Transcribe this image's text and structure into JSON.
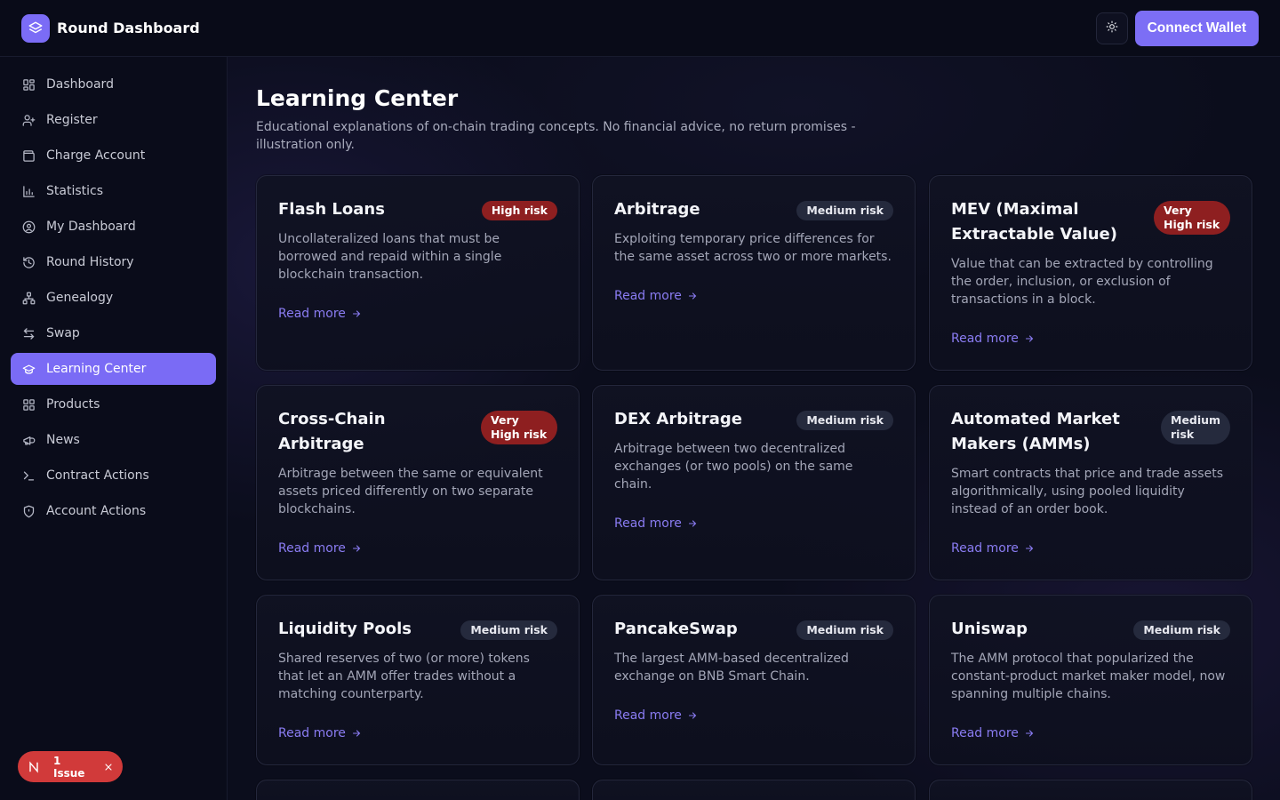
{
  "header": {
    "title": "Round Dashboard",
    "connect_label": "Connect Wallet"
  },
  "sidebar": {
    "items": [
      {
        "label": "Dashboard",
        "icon": "grid-icon"
      },
      {
        "label": "Register",
        "icon": "user-plus-icon"
      },
      {
        "label": "Charge Account",
        "icon": "wallet-icon"
      },
      {
        "label": "Statistics",
        "icon": "bar-chart-icon"
      },
      {
        "label": "My Dashboard",
        "icon": "user-circle-icon"
      },
      {
        "label": "Round History",
        "icon": "history-icon"
      },
      {
        "label": "Genealogy",
        "icon": "network-icon"
      },
      {
        "label": "Swap",
        "icon": "swap-icon"
      },
      {
        "label": "Learning Center",
        "icon": "graduation-cap-icon",
        "active": true
      },
      {
        "label": "Products",
        "icon": "grid-icon"
      },
      {
        "label": "News",
        "icon": "megaphone-icon"
      },
      {
        "label": "Contract Actions",
        "icon": "terminal-icon"
      },
      {
        "label": "Account Actions",
        "icon": "shield-icon"
      }
    ]
  },
  "issue_pill": {
    "label": "1 Issue",
    "color": "#d13a3a"
  },
  "main": {
    "title": "Learning Center",
    "subtitle": "Educational explanations of on-chain trading concepts. No financial advice, no return promises - illustration only.",
    "read_more_label": "Read more",
    "cards": [
      {
        "title": "Flash Loans",
        "risk": "High risk",
        "risk_level": "high",
        "desc": "Uncollateralized loans that must be borrowed and repaid within a single blockchain transaction."
      },
      {
        "title": "Arbitrage",
        "risk": "Medium risk",
        "risk_level": "medium",
        "desc": "Exploiting temporary price differences for the same asset across two or more markets."
      },
      {
        "title": "MEV (Maximal Extractable Value)",
        "risk": "Very High risk",
        "risk_level": "vhigh",
        "desc": "Value that can be extracted by controlling the order, inclusion, or exclusion of transactions in a block."
      },
      {
        "title": "Cross-Chain Arbitrage",
        "risk": "Very High risk",
        "risk_level": "vhigh",
        "desc": "Arbitrage between the same or equivalent assets priced differently on two separate blockchains."
      },
      {
        "title": "DEX Arbitrage",
        "risk": "Medium risk",
        "risk_level": "medium",
        "desc": "Arbitrage between two decentralized exchanges (or two pools) on the same chain."
      },
      {
        "title": "Automated Market Makers (AMMs)",
        "risk": "Medium risk",
        "risk_level": "medium",
        "desc": "Smart contracts that price and trade assets algorithmically, using pooled liquidity instead of an order book."
      },
      {
        "title": "Liquidity Pools",
        "risk": "Medium risk",
        "risk_level": "medium",
        "desc": "Shared reserves of two (or more) tokens that let an AMM offer trades without a matching counterparty."
      },
      {
        "title": "PancakeSwap",
        "risk": "Medium risk",
        "risk_level": "medium",
        "desc": "The largest AMM-based decentralized exchange on BNB Smart Chain."
      },
      {
        "title": "Uniswap",
        "risk": "Medium risk",
        "risk_level": "medium",
        "desc": "The AMM protocol that popularized the constant-product market maker model, now spanning multiple chains."
      }
    ]
  },
  "colors": {
    "accent": "#7c6ef5",
    "high_risk": "#8e1f20",
    "medium_risk": "#252a3d",
    "background": "#0b0d1c"
  }
}
